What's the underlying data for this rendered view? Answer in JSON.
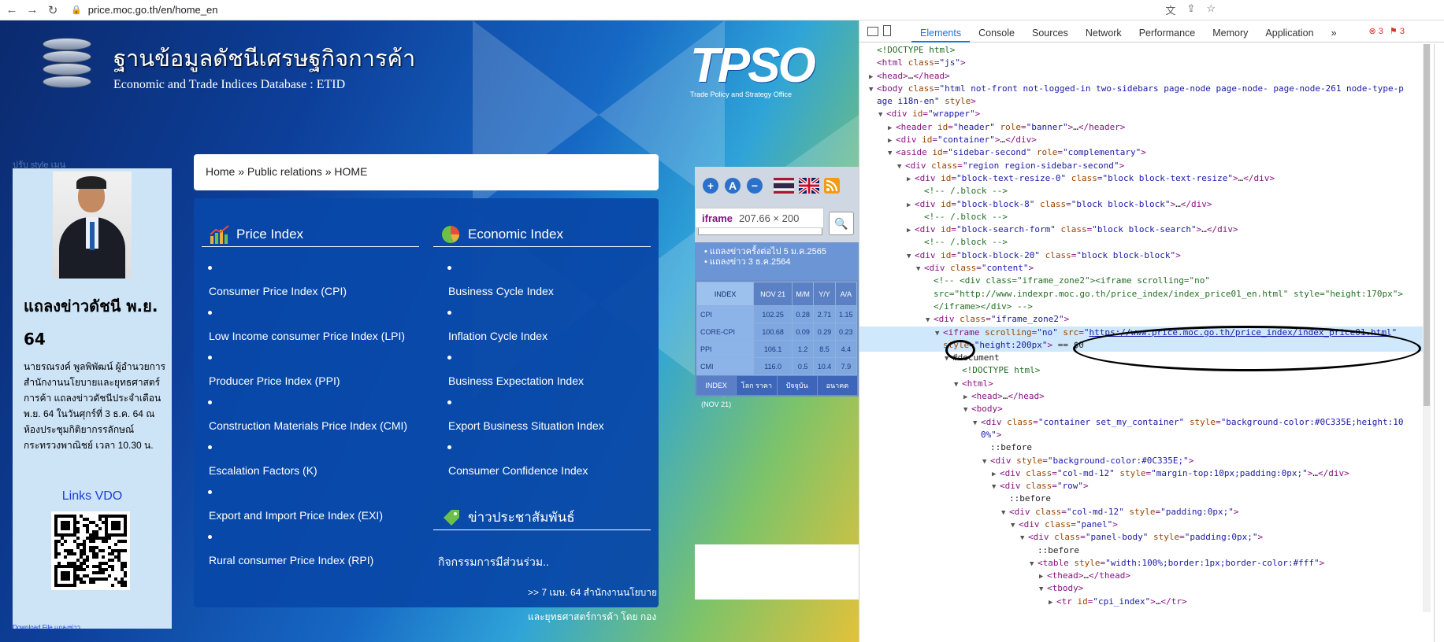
{
  "browser": {
    "url": "price.moc.go.th/en/home_en"
  },
  "site": {
    "logo_th": "ฐานข้อมูลดัชนีเศรษฐกิจการค้า",
    "logo_en": "Economic and Trade Indices Database : ETID",
    "tpso_text": "TPSO",
    "tpso_sub": "Trade Policy and Strategy Office",
    "style_menu": "ปรับ style เมนู",
    "breadcrumb": "Home » Public relations » HOME",
    "left": {
      "news_title": "แถลงข่าวดัชนี พ.ย. 64",
      "news_body": "นายรณรงค์ พูลพิพัฒน์ ผู้อำนวยการสำนักงานนโยบายและยุทธศาสตร์การค้า แถลงข่าวดัชนีประจำเดือน พ.ย. 64 ในวันศุกร์ที่ 3 ธ.ค. 64 ณ ห้องประชุมกิติยากรรลักษณ์ กระทรวงพาณิชย์ เวลา 10.30 น.",
      "links_vdo": "Links VDO",
      "download": "Download File แถลงข่าว"
    },
    "price_index": {
      "title": "Price Index",
      "items": [
        "Consumer Price Index (CPI)",
        "Low Income consumer Price Index (LPI)",
        "Producer Price Index (PPI)",
        "Construction Materials Price Index (CMI)",
        "Escalation Factors (K)",
        "Export and Import Price Index (EXI)",
        "Rural consumer Price Index (RPI)"
      ]
    },
    "economic_index": {
      "title": "Economic Index",
      "items": [
        "Business Cycle Index",
        "Inflation Cycle Index",
        "Business Expectation Index",
        "Export Business Situation Index",
        "Consumer Confidence Index"
      ]
    },
    "pr": {
      "title": "ข่าวประชาสัมพันธ์",
      "n1": "กิจกรรมการมีส่วนร่วม..",
      "n2": ">> 7 เมษ. 64 สำนักงานนโยบาย",
      "n3": "และยุทธศาสตร์การค้า โดย กอง"
    },
    "widget": {
      "btn_plus": "+",
      "btn_a": "A",
      "btn_minus": "−",
      "iframe_tag": "iframe",
      "iframe_size": "207.66 × 200",
      "banner1": "• แถลงข่าวครั้งต่อไป 5 ม.ค.2565",
      "banner2": "• แถลงข่าว 3 ธ.ค.2564",
      "headers": [
        "INDEX",
        "NOV 21",
        "M/M",
        "Y/Y",
        "A/A"
      ],
      "rows": [
        [
          "CPI",
          "102.25",
          "0.28",
          "2.71",
          "1.15"
        ],
        [
          "CORE-CPI",
          "100.68",
          "0.09",
          "0.29",
          "0.23"
        ],
        [
          "PPI",
          "106.1",
          "1.2",
          "8.5",
          "4.4"
        ],
        [
          "CMI",
          "116.0",
          "0.5",
          "10.4",
          "7.9"
        ]
      ],
      "foot": [
        "INDEX (NOV 21)",
        "โลก ราคา",
        "ปัจจุบัน",
        "อนาคต"
      ]
    }
  },
  "devtools": {
    "tabs": [
      "Elements",
      "Console",
      "Sources",
      "Network",
      "Performance",
      "Memory",
      "Application",
      "»"
    ],
    "errors": "3",
    "warnings": "3",
    "lines": [
      {
        "i": 0,
        "t": "",
        "h": "<span class='cm'>&lt;!DOCTYPE html&gt;</span>"
      },
      {
        "i": 0,
        "t": "",
        "h": "&lt;html <span class='at'>class</span>=<span class='av'>\"js\"</span>&gt;"
      },
      {
        "i": 0,
        "t": "▶",
        "h": "&lt;head&gt;<span class='tx'>…</span>&lt;/head&gt;"
      },
      {
        "i": 0,
        "t": "▼",
        "h": "&lt;body <span class='at'>class</span>=<span class='av'>\"html not-front not-logged-in two-sidebars page-node page-node- page-node-261 node-type-p</span>"
      },
      {
        "i": 0,
        "t": "",
        "h": "<span class='av'>age i18n-en\"</span> <span class='at'>style</span>&gt;"
      },
      {
        "i": 1,
        "t": "▼",
        "h": "&lt;div <span class='at'>id</span>=<span class='av'>\"wrapper\"</span>&gt;"
      },
      {
        "i": 2,
        "t": "▶",
        "h": "&lt;header <span class='at'>id</span>=<span class='av'>\"header\"</span> <span class='at'>role</span>=<span class='av'>\"banner\"</span>&gt;<span class='tx'>…</span>&lt;/header&gt;"
      },
      {
        "i": 2,
        "t": "▶",
        "h": "&lt;div <span class='at'>id</span>=<span class='av'>\"container\"</span>&gt;<span class='tx'>…</span>&lt;/div&gt;"
      },
      {
        "i": 2,
        "t": "▼",
        "h": "&lt;aside <span class='at'>id</span>=<span class='av'>\"sidebar-second\"</span> <span class='at'>role</span>=<span class='av'>\"complementary\"</span>&gt;"
      },
      {
        "i": 3,
        "t": "▼",
        "h": "&lt;div <span class='at'>class</span>=<span class='av'>\"region region-sidebar-second\"</span>&gt;"
      },
      {
        "i": 4,
        "t": "▶",
        "h": "&lt;div <span class='at'>id</span>=<span class='av'>\"block-text-resize-0\"</span> <span class='at'>class</span>=<span class='av'>\"block block-text-resize\"</span>&gt;<span class='tx'>…</span>&lt;/div&gt;"
      },
      {
        "i": 5,
        "t": "",
        "h": "<span class='cm'>&lt;!-- /.block --&gt;</span>"
      },
      {
        "i": 4,
        "t": "▶",
        "h": "&lt;div <span class='at'>id</span>=<span class='av'>\"block-block-8\"</span> <span class='at'>class</span>=<span class='av'>\"block block-block\"</span>&gt;<span class='tx'>…</span>&lt;/div&gt;"
      },
      {
        "i": 5,
        "t": "",
        "h": "<span class='cm'>&lt;!-- /.block --&gt;</span>"
      },
      {
        "i": 4,
        "t": "▶",
        "h": "&lt;div <span class='at'>id</span>=<span class='av'>\"block-search-form\"</span> <span class='at'>class</span>=<span class='av'>\"block block-search\"</span>&gt;<span class='tx'>…</span>&lt;/div&gt;"
      },
      {
        "i": 5,
        "t": "",
        "h": "<span class='cm'>&lt;!-- /.block --&gt;</span>"
      },
      {
        "i": 4,
        "t": "▼",
        "h": "&lt;div <span class='at'>id</span>=<span class='av'>\"block-block-20\"</span> <span class='at'>class</span>=<span class='av'>\"block block-block\"</span>&gt;"
      },
      {
        "i": 5,
        "t": "▼",
        "h": "&lt;div <span class='at'>class</span>=<span class='av'>\"content\"</span>&gt;"
      },
      {
        "i": 6,
        "t": "",
        "h": "<span class='cm'>&lt;!-- &lt;div class=\"iframe_zone2\"&gt;&lt;iframe scrolling=\"no\"</span>"
      },
      {
        "i": 6,
        "t": "",
        "h": "<span class='cm'>src=\"http://www.indexpr.moc.go.th/price_index/index_price01_en.html\" style=\"height:170px\"&gt;</span>"
      },
      {
        "i": 6,
        "t": "",
        "h": "<span class='cm'>&lt;/iframe&gt;&lt;/div&gt; --&gt;</span>"
      },
      {
        "i": 6,
        "t": "▼",
        "h": "&lt;div <span class='at'>class</span>=<span class='av'>\"iframe_zone2\"</span>&gt;"
      },
      {
        "i": 7,
        "t": "▼",
        "h": "&lt;iframe <span class='at'>scrolling</span>=<span class='av'>\"no\"</span> <span class='at'>src</span>=<span class='av'>\"</span><span class='lk'>https://www.price.moc.go.th/price_index/index_price01.html</span><span class='av'>\"</span>",
        "sel": true
      },
      {
        "i": 7,
        "t": "",
        "h": "<span class='at'>style</span>=<span class='av'>\"height:200px\"</span>&gt; <span class='tx'>== $0</span>",
        "sel": true
      },
      {
        "i": 8,
        "t": "▼",
        "h": "<span class='tx'>#document</span>"
      },
      {
        "i": 9,
        "t": "",
        "h": "<span class='cm'>&lt;!DOCTYPE html&gt;</span>"
      },
      {
        "i": 9,
        "t": "▼",
        "h": "&lt;html&gt;"
      },
      {
        "i": 10,
        "t": "▶",
        "h": "&lt;head&gt;<span class='tx'>…</span>&lt;/head&gt;"
      },
      {
        "i": 10,
        "t": "▼",
        "h": "&lt;body&gt;"
      },
      {
        "i": 11,
        "t": "▼",
        "h": "&lt;div <span class='at'>class</span>=<span class='av'>\"container set_my_container\"</span> <span class='at'>style</span>=<span class='av'>\"background-color:#0C335E;height:10</span>"
      },
      {
        "i": 11,
        "t": "",
        "h": "<span class='av'>0%\"</span>&gt;"
      },
      {
        "i": 12,
        "t": "",
        "h": "<span class='tx'>::before</span>"
      },
      {
        "i": 12,
        "t": "▼",
        "h": "&lt;div <span class='at'>style</span>=<span class='av'>\"background-color:#0C335E;\"</span>&gt;"
      },
      {
        "i": 13,
        "t": "▶",
        "h": "&lt;div <span class='at'>class</span>=<span class='av'>\"col-md-12\"</span> <span class='at'>style</span>=<span class='av'>\"margin-top:10px;padding:0px;\"</span>&gt;<span class='tx'>…</span>&lt;/div&gt;"
      },
      {
        "i": 13,
        "t": "▼",
        "h": "&lt;div <span class='at'>class</span>=<span class='av'>\"row\"</span>&gt;"
      },
      {
        "i": 14,
        "t": "",
        "h": "<span class='tx'>::before</span>"
      },
      {
        "i": 14,
        "t": "▼",
        "h": "&lt;div <span class='at'>class</span>=<span class='av'>\"col-md-12\"</span> <span class='at'>style</span>=<span class='av'>\"padding:0px;\"</span>&gt;"
      },
      {
        "i": 15,
        "t": "▼",
        "h": "&lt;div <span class='at'>class</span>=<span class='av'>\"panel\"</span>&gt;"
      },
      {
        "i": 16,
        "t": "▼",
        "h": "&lt;div <span class='at'>class</span>=<span class='av'>\"panel-body\"</span> <span class='at'>style</span>=<span class='av'>\"padding:0px;\"</span>&gt;"
      },
      {
        "i": 17,
        "t": "",
        "h": "<span class='tx'>::before</span>"
      },
      {
        "i": 17,
        "t": "▼",
        "h": "&lt;table <span class='at'>style</span>=<span class='av'>\"width:100%;border:1px;border-color:#fff\"</span>&gt;"
      },
      {
        "i": 18,
        "t": "▶",
        "h": "&lt;thead&gt;<span class='tx'>…</span>&lt;/thead&gt;"
      },
      {
        "i": 18,
        "t": "▼",
        "h": "&lt;tbody&gt;"
      },
      {
        "i": 19,
        "t": "▶",
        "h": "&lt;tr <span class='at'>id</span>=<span class='av'>\"cpi_index\"</span>&gt;<span class='tx'>…</span>&lt;/tr&gt;"
      }
    ]
  }
}
